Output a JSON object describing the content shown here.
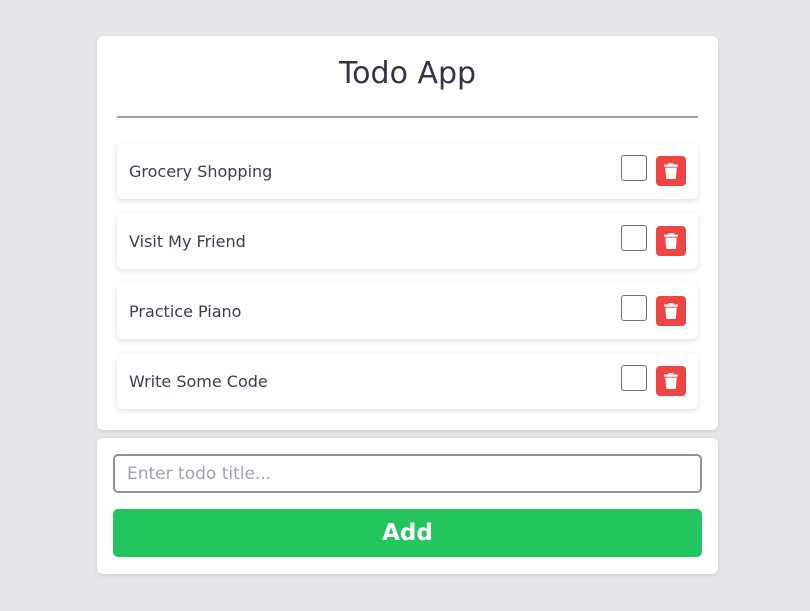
{
  "app": {
    "title": "Todo App"
  },
  "todos": [
    {
      "label": "Grocery Shopping",
      "checked": false
    },
    {
      "label": "Visit My Friend",
      "checked": false
    },
    {
      "label": "Practice Piano",
      "checked": false
    },
    {
      "label": "Write Some Code",
      "checked": false
    }
  ],
  "form": {
    "placeholder": "Enter todo title...",
    "value": "",
    "add_label": "Add"
  },
  "icons": {
    "delete": "trash-icon"
  },
  "colors": {
    "background": "#e5e7eb",
    "delete": "#ef4444",
    "add": "#22c55e",
    "text": "#374151"
  }
}
